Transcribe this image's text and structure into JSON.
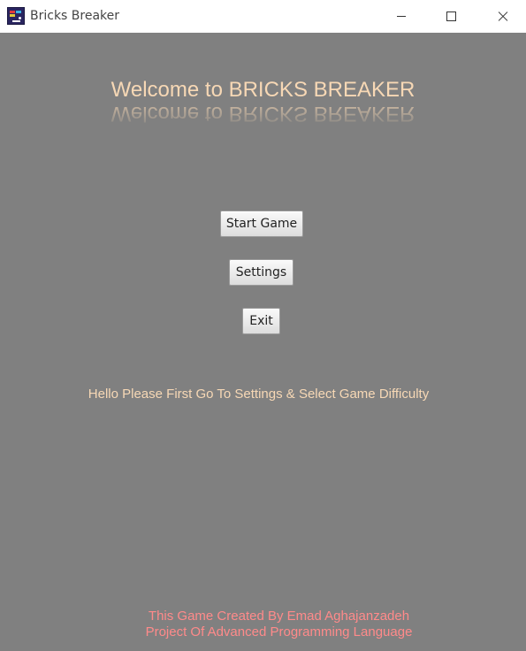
{
  "window": {
    "title": "Bricks Breaker",
    "app_icon": "bricks-breaker-app-icon",
    "controls": {
      "minimize_icon": "minimize-icon",
      "maximize_icon": "maximize-icon",
      "close_icon": "close-icon"
    }
  },
  "main": {
    "welcome_text": "Welcome to BRICKS BREAKER",
    "buttons": {
      "start": "Start Game",
      "settings": "Settings",
      "exit": "Exit"
    },
    "hint": "Hello Please First Go To Settings & Select Game Difficulty",
    "credits": {
      "line1": "This Game Created By Emad Aghajanzadeh",
      "line2": "Project Of Advanced Programming Language"
    }
  },
  "colors": {
    "background": "#808080",
    "welcome_text": "#f7d8b5",
    "hint_text": "#f7d8b5",
    "credits_text": "#ff8a8a"
  }
}
